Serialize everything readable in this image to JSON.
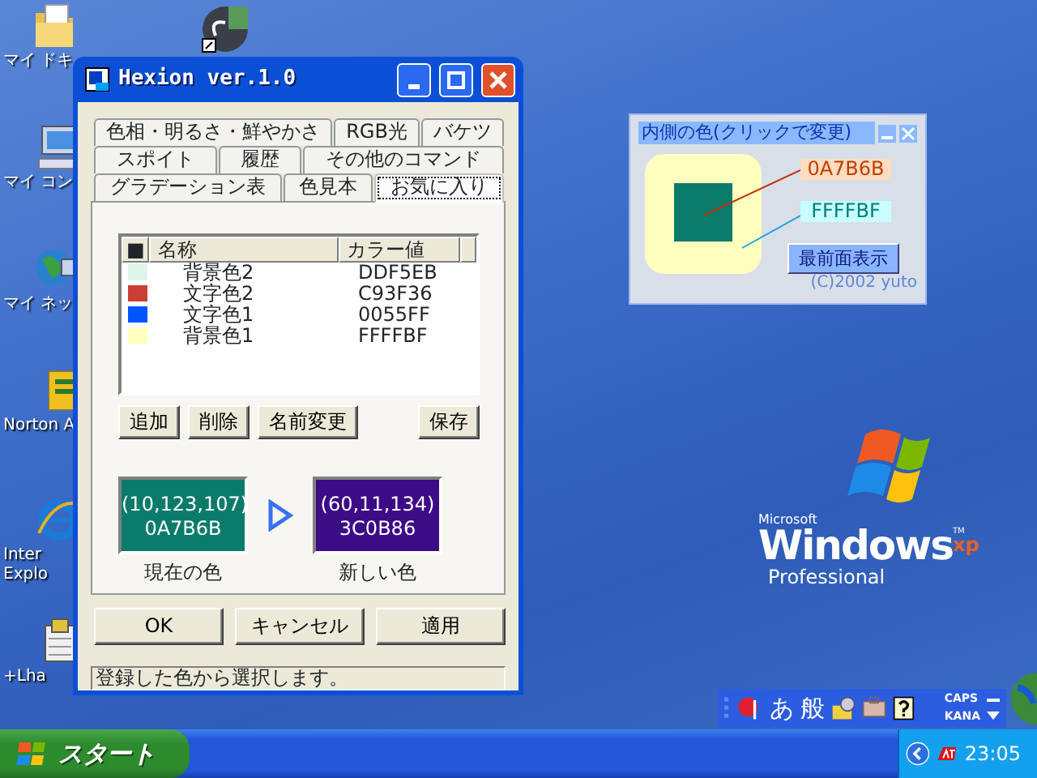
{
  "desktop_icons": [
    {
      "kind": "folder",
      "label": "マイ ドキ"
    },
    {
      "kind": "shortcut"
    },
    {
      "kind": "computer",
      "label": "マイ コン"
    },
    {
      "kind": "network",
      "label": "マイ ネッ"
    },
    {
      "kind": "norton",
      "label": "Norton A"
    },
    {
      "kind": "browser",
      "label": "Inter\nExplo"
    },
    {
      "kind": "archive",
      "label": "+Lha"
    }
  ],
  "main_window": {
    "title": "Hexion ver.1.0",
    "tab_rows": [
      [
        {
          "label": "色相・明るさ・鮮やかさ",
          "selected": false
        },
        {
          "label": "RGB光",
          "selected": false
        },
        {
          "label": "バケツ",
          "selected": false
        }
      ],
      [
        {
          "label": "スポイト",
          "selected": false
        },
        {
          "label": "履歴",
          "selected": false
        },
        {
          "label": "その他のコマンド",
          "selected": false
        }
      ],
      [
        {
          "label": "グラデーション表",
          "selected": false
        },
        {
          "label": "色見本",
          "selected": false
        },
        {
          "label": "お気に入り",
          "selected": true
        }
      ]
    ],
    "list": {
      "columns": [
        "■",
        "名称",
        "カラー値"
      ],
      "rows": [
        {
          "color": "#ddf5eb",
          "name": "背景色2",
          "value": "DDF5EB"
        },
        {
          "color": "#c93f36",
          "name": "文字色2",
          "value": "C93F36"
        },
        {
          "color": "#0055ff",
          "name": "文字色1",
          "value": "0055FF"
        },
        {
          "color": "#ffffbf",
          "name": "背景色1",
          "value": "FFFFBF"
        }
      ]
    },
    "list_buttons": [
      "追加",
      "削除",
      "名前変更",
      "保存"
    ],
    "colors": [
      {
        "color": "#0a7b6b",
        "rgb": "(10,123,107)",
        "hex": "0A7B6B",
        "label": "現在の色"
      },
      {
        "color": "#3c0b86",
        "rgb": "(60,11,134)",
        "hex": "3C0B86",
        "label": "新しい色"
      }
    ],
    "dialog_buttons": [
      "OK",
      "キャンセル",
      "適用"
    ],
    "status_bar": "登録した色から選択します。"
  },
  "inner_color_window": {
    "title": "内側の色(クリックで変更)",
    "inner_hex": "0A7B6B",
    "outer_hex": "FFFFBF",
    "button": "最前面表示",
    "credit": "(C)2002 yuto"
  },
  "branding": {
    "maker": "Microsoft",
    "product": "Windows",
    "version": "xp",
    "tm": "TM",
    "edition": "Professional"
  },
  "language_bar": {
    "mode": "あ",
    "dictionary": "般",
    "caps": "CAPS",
    "kana": "KANA"
  },
  "taskbar": {
    "start": "スタート",
    "clock": "23:05"
  }
}
